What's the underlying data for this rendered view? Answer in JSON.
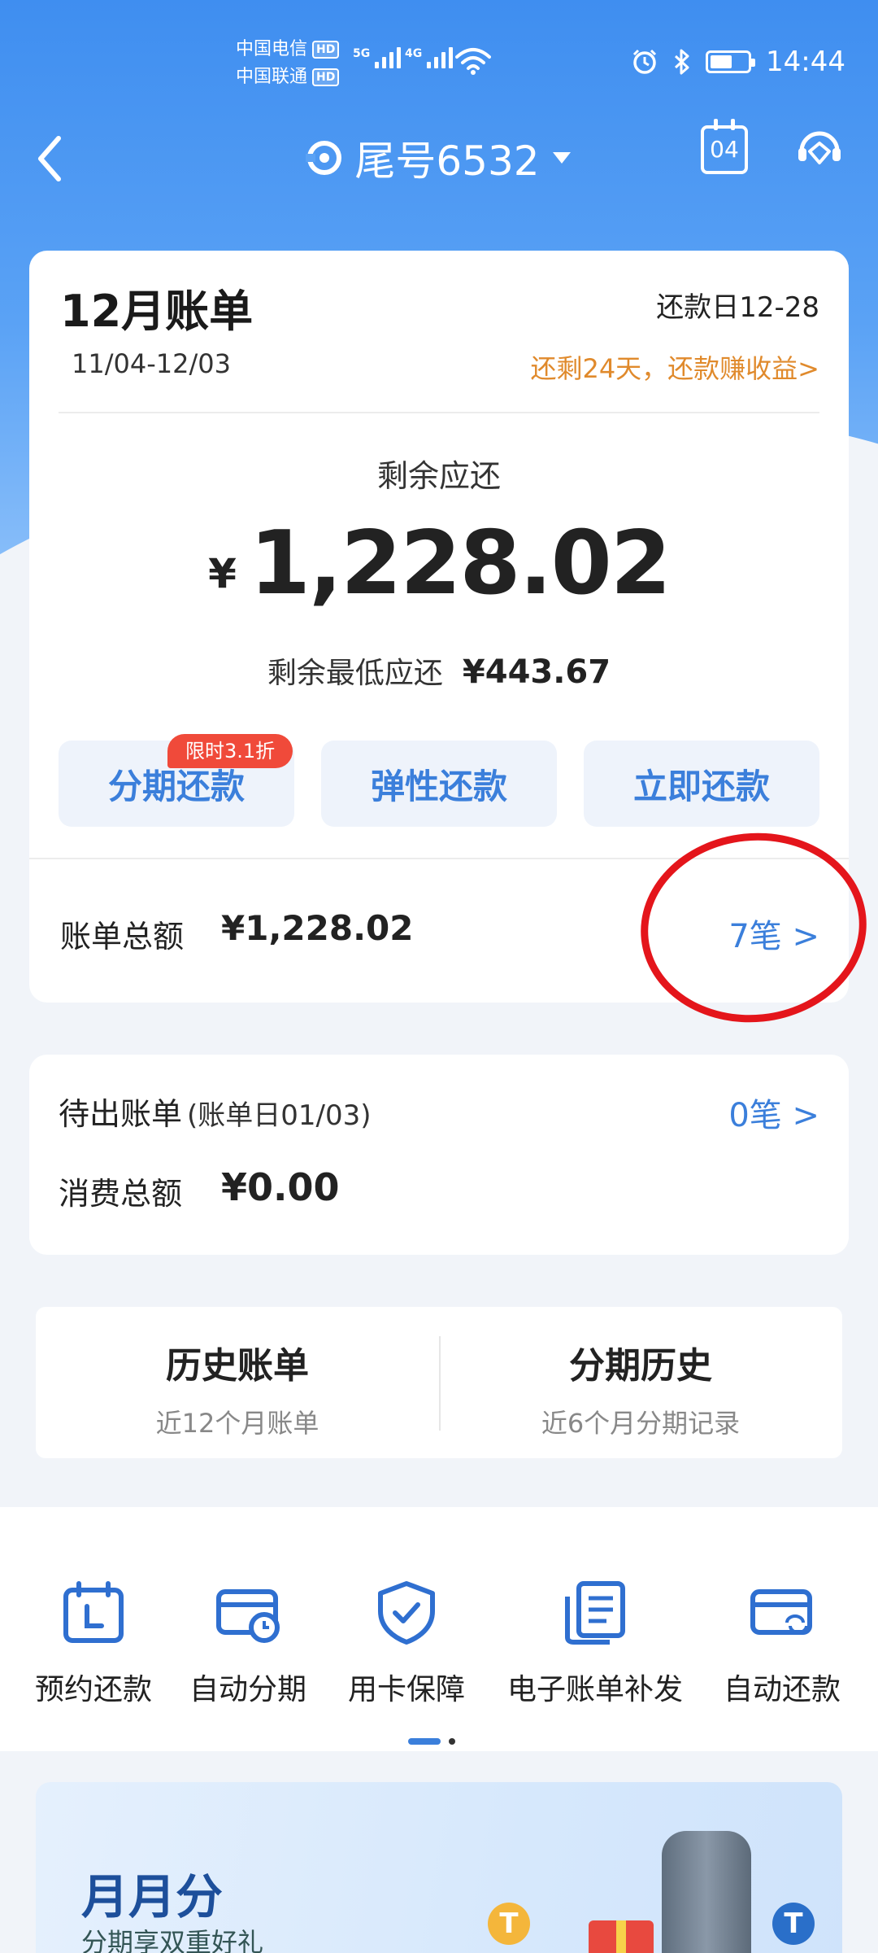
{
  "status_bar": {
    "carrier1": "中国电信",
    "carrier2": "中国联通",
    "hd": "HD",
    "net1": "5G",
    "net2": "4G",
    "time": "14:44",
    "battery_level": 0.6
  },
  "nav": {
    "card_label": "尾号6532",
    "calendar_day": "04"
  },
  "bill": {
    "month_title": "12月账单",
    "due_date": "还款日12-28",
    "period": "11/04-12/03",
    "remaining_days_link": "还剩24天，还款赚收益>",
    "remaining_label": "剩余应还",
    "currency": "¥",
    "remaining_amount": "1,228.02",
    "min_label": "剩余最低应还",
    "min_amount": "¥443.67",
    "buttons": {
      "installment": "分期还款",
      "installment_badge": "限时3.1折",
      "flexible": "弹性还款",
      "pay_now": "立即还款"
    },
    "total_label": "账单总额",
    "total_amount": "¥1,228.02",
    "total_count": "7笔 >"
  },
  "pending": {
    "label": "待出账单",
    "statement_date": "(账单日01/03)",
    "count": "0笔 >",
    "spend_label": "消费总额",
    "spend_amount": "¥0.00"
  },
  "history": {
    "bills_title": "历史账单",
    "bills_sub": "近12个月账单",
    "installments_title": "分期历史",
    "installments_sub": "近6个月分期记录"
  },
  "services": [
    {
      "label": "预约还款",
      "icon": "calendar-l-icon"
    },
    {
      "label": "自动分期",
      "icon": "card-clock-icon"
    },
    {
      "label": "用卡保障",
      "icon": "shield-check-icon"
    },
    {
      "label": "电子账单补发",
      "icon": "document-icon"
    },
    {
      "label": "自动还款",
      "icon": "card-refresh-icon"
    }
  ],
  "promo": {
    "title": "月月分",
    "subtitle": "分期享双重好礼"
  },
  "colors": {
    "primary_blue": "#3b7fdb",
    "orange_link": "#e08a2c",
    "badge_red": "#f04a3a",
    "annotation_red": "#e4151b"
  }
}
